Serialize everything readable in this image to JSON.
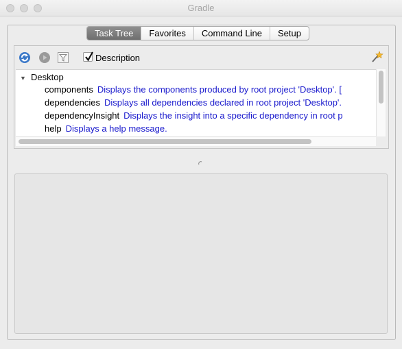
{
  "window": {
    "title": "Gradle"
  },
  "tabs": [
    {
      "label": "Task Tree",
      "active": true
    },
    {
      "label": "Favorites",
      "active": false
    },
    {
      "label": "Command Line",
      "active": false
    },
    {
      "label": "Setup",
      "active": false
    }
  ],
  "toolbar": {
    "refresh_icon": "refresh-icon",
    "stop_icon": "stop-icon",
    "filter_icon": "filter-icon",
    "description_checkbox": {
      "label": "Description",
      "checked": true
    },
    "options_icon": "wand-icon"
  },
  "tree": {
    "root": {
      "label": "Desktop",
      "expanded": true
    },
    "tasks": [
      {
        "name": "components",
        "description": "Displays the components produced by root project 'Desktop'. ["
      },
      {
        "name": "dependencies",
        "description": "Displays all dependencies declared in root project 'Desktop'."
      },
      {
        "name": "dependencyInsight",
        "description": "Displays the insight into a specific dependency in root p"
      },
      {
        "name": "help",
        "description": "Displays a help message."
      }
    ]
  },
  "colors": {
    "task_description": "#1a1acd",
    "active_tab": "#7d7d7d",
    "refresh_icon": "#3a78c8"
  }
}
